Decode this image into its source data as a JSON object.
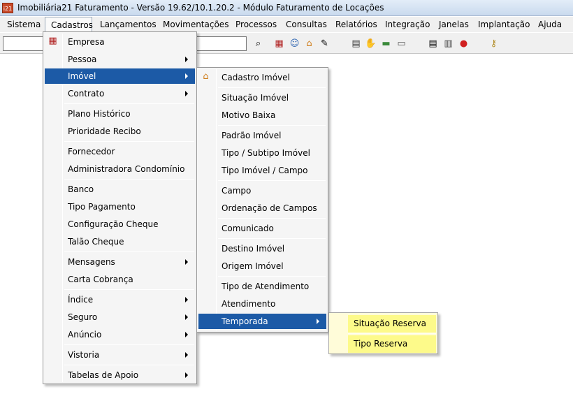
{
  "window": {
    "title": "Imobiliária21 Faturamento - Versão 19.62/10.1.20.2 - Módulo Faturamento de Locações",
    "app_icon_text": "i21"
  },
  "menubar": {
    "items": [
      "Sistema",
      "Cadastros",
      "Lançamentos",
      "Movimentações",
      "Processos",
      "Consultas",
      "Relatórios",
      "Integração",
      "Janelas",
      "Implantação",
      "Ajuda"
    ],
    "active": "Cadastros"
  },
  "toolbar": {
    "input1_value": "",
    "input2_value": "",
    "icons": [
      "binoculars-icon",
      "calculator-icon",
      "user-icon",
      "home-icon",
      "edit-icon",
      "printer-icon",
      "handshake-icon",
      "cash-icon",
      "card-icon",
      "print-doc-icon",
      "agenda-icon",
      "stop-icon",
      "key-icon"
    ]
  },
  "cadastros_menu": {
    "items": [
      {
        "label": "Empresa",
        "submenu": false
      },
      {
        "label": "Pessoa",
        "submenu": true
      },
      {
        "label": "Imóvel",
        "submenu": true
      },
      {
        "label": "Contrato",
        "submenu": true
      },
      {
        "label": "Plano Histórico",
        "submenu": false
      },
      {
        "label": "Prioridade Recibo",
        "submenu": false
      },
      {
        "label": "Fornecedor",
        "submenu": false
      },
      {
        "label": "Administradora Condomínio",
        "submenu": false
      },
      {
        "label": "Banco",
        "submenu": false
      },
      {
        "label": "Tipo Pagamento",
        "submenu": false
      },
      {
        "label": "Configuração Cheque",
        "submenu": false
      },
      {
        "label": "Talão Cheque",
        "submenu": false
      },
      {
        "label": "Mensagens",
        "submenu": true
      },
      {
        "label": "Carta Cobrança",
        "submenu": false
      },
      {
        "label": "Índice",
        "submenu": true
      },
      {
        "label": "Seguro",
        "submenu": true
      },
      {
        "label": "Anúncio",
        "submenu": true
      },
      {
        "label": "Vistoria",
        "submenu": true
      },
      {
        "label": "Tabelas de Apoio",
        "submenu": true
      }
    ],
    "highlighted": "Imóvel"
  },
  "imovel_menu": {
    "items": [
      {
        "label": "Cadastro Imóvel",
        "submenu": false
      },
      {
        "label": "Situação Imóvel",
        "submenu": false
      },
      {
        "label": "Motivo Baixa",
        "submenu": false
      },
      {
        "label": "Padrão Imóvel",
        "submenu": false
      },
      {
        "label": "Tipo / Subtipo Imóvel",
        "submenu": false
      },
      {
        "label": "Tipo Imóvel / Campo",
        "submenu": false
      },
      {
        "label": "Campo",
        "submenu": false
      },
      {
        "label": "Ordenação de Campos",
        "submenu": false
      },
      {
        "label": "Comunicado",
        "submenu": false
      },
      {
        "label": "Destino Imóvel",
        "submenu": false
      },
      {
        "label": "Origem Imóvel",
        "submenu": false
      },
      {
        "label": "Tipo de Atendimento",
        "submenu": false
      },
      {
        "label": "Atendimento",
        "submenu": false
      },
      {
        "label": "Temporada",
        "submenu": true
      }
    ],
    "highlighted": "Temporada"
  },
  "temporada_menu": {
    "items": [
      {
        "label": "Situação Reserva"
      },
      {
        "label": "Tipo Reserva"
      }
    ]
  },
  "colors": {
    "highlight": "#1c5aa6",
    "submenu_background": "#fffcd9",
    "submenu_item": "#fdfa8a"
  }
}
